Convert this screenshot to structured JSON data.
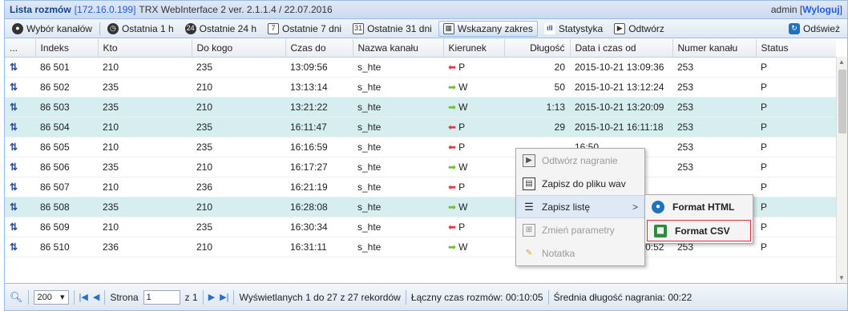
{
  "titlebar": {
    "title": "Lista rozmów",
    "ip": "[172.16.0.199]",
    "version": "TRX WebInterface 2 ver. 2.1.1.4 / 22.07.2016",
    "user": "admin [",
    "logout": "Wyloguj",
    "user_close": "]"
  },
  "toolbar": {
    "channels": "Wybór kanałów",
    "last1h": "Ostatnia 1 h",
    "last24h": "Ostatnie 24 h",
    "last7d": "Ostatnie 7 dni",
    "last31d": "Ostatnie 31 dni",
    "range": "Wskazany zakres",
    "stats": "Statystyka",
    "play": "Odtwórz",
    "refresh": "Odśwież",
    "icon_7": "7",
    "icon_31": "31",
    "icon_24": "24"
  },
  "columns": {
    "c0": "...",
    "c1": "Indeks",
    "c2": "Kto",
    "c3": "Do kogo",
    "c4": "Czas do",
    "c5": "Nazwa kanału",
    "c6": "Kierunek",
    "c7": "Długość",
    "c8": "Data i czas od",
    "c9": "Numer kanału",
    "c10": "Status"
  },
  "rows": [
    {
      "idx": "86 501",
      "kto": "210",
      "dokogo": "235",
      "czas": "13:09:56",
      "kanal": "s_hte",
      "kier": "P",
      "dir": "in",
      "dl": "20",
      "data": "2015-10-21 13:09:36",
      "nr": "253",
      "status": "P"
    },
    {
      "idx": "86 502",
      "kto": "235",
      "dokogo": "210",
      "czas": "13:13:14",
      "kanal": "s_hte",
      "kier": "W",
      "dir": "out",
      "dl": "50",
      "data": "2015-10-21 13:12:24",
      "nr": "253",
      "status": "P"
    },
    {
      "idx": "86 503",
      "kto": "235",
      "dokogo": "210",
      "czas": "13:21:22",
      "kanal": "s_hte",
      "kier": "W",
      "dir": "out",
      "dl": "1:13",
      "data": "2015-10-21 13:20:09",
      "nr": "253",
      "status": "P"
    },
    {
      "idx": "86 504",
      "kto": "210",
      "dokogo": "235",
      "czas": "16:11:47",
      "kanal": "s_hte",
      "kier": "P",
      "dir": "in",
      "dl": "29",
      "data": "2015-10-21 16:11:18",
      "nr": "253",
      "status": "P"
    },
    {
      "idx": "86 505",
      "kto": "210",
      "dokogo": "235",
      "czas": "16:16:59",
      "kanal": "s_hte",
      "kier": "P",
      "dir": "in",
      "dl": "",
      "data": "16:50",
      "nr": "253",
      "status": "P"
    },
    {
      "idx": "86 506",
      "kto": "235",
      "dokogo": "210",
      "czas": "16:17:27",
      "kanal": "s_hte",
      "kier": "W",
      "dir": "out",
      "dl": "",
      "data": "17:12",
      "nr": "253",
      "status": "P"
    },
    {
      "idx": "86 507",
      "kto": "210",
      "dokogo": "236",
      "czas": "16:21:19",
      "kanal": "s_hte",
      "kier": "P",
      "dir": "in",
      "dl": "",
      "data": "",
      "nr": "",
      "status": "P"
    },
    {
      "idx": "86 508",
      "kto": "235",
      "dokogo": "210",
      "czas": "16:28:08",
      "kanal": "s_hte",
      "kier": "W",
      "dir": "out",
      "dl": "",
      "data": "",
      "nr": "",
      "status": "P"
    },
    {
      "idx": "86 509",
      "kto": "210",
      "dokogo": "235",
      "czas": "16:30:34",
      "kanal": "s_hte",
      "kier": "P",
      "dir": "in",
      "dl": "",
      "data": "30:08",
      "nr": "253",
      "status": "P"
    },
    {
      "idx": "86 510",
      "kto": "236",
      "dokogo": "210",
      "czas": "16:31:11",
      "kanal": "s_hte",
      "kier": "W",
      "dir": "out",
      "dl": "19",
      "data": "2015-10-21 16:30:52",
      "nr": "253",
      "status": "P"
    }
  ],
  "context_menu": {
    "play": "Odtwórz nagranie",
    "save_wav": "Zapisz do pliku wav",
    "save_list": "Zapisz listę",
    "change": "Zmień parametry",
    "note": "Notatka",
    "sub_arrow": ">"
  },
  "submenu": {
    "html": "Format HTML",
    "csv": "Format CSV"
  },
  "pager": {
    "page_size": "200",
    "page_label": "Strona",
    "page_value": "1",
    "of": "z 1",
    "display": "Wyświetlanych 1 do 27 z 27 rekordów",
    "total": "Łączny czas rozmów: 00:10:05",
    "avg": "Średnia długość nagrania: 00:22"
  },
  "colors": {
    "accent": "#15428b",
    "row_alt": "#d6eef0",
    "dir_in": "#e03a3a",
    "dir_out": "#6fbf3a",
    "highlight_border": "#d7333a"
  }
}
